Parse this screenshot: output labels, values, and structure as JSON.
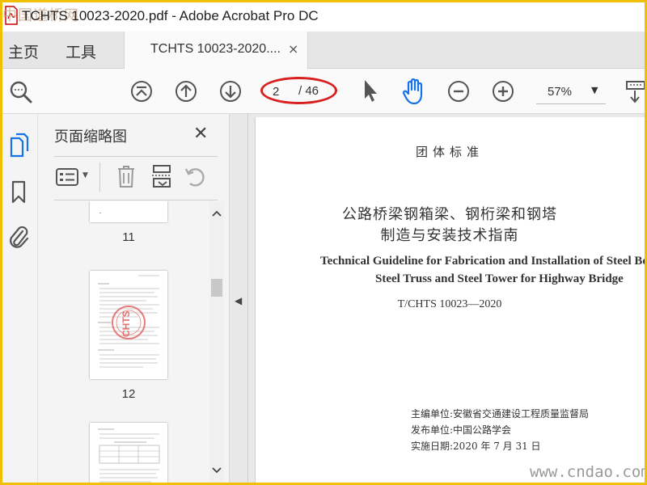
{
  "window": {
    "title": "TCHTS 10023-2020.pdf - Adobe Acrobat Pro DC",
    "watermark": "中国道桥网"
  },
  "tabs": {
    "home": "主页",
    "tools": "工具",
    "document": "TCHTS 10023-2020....",
    "close": "×"
  },
  "toolbar": {
    "current_page": "2",
    "total_pages": "/ 46",
    "zoom": "57%",
    "zoom_caret": "▼",
    "icons": [
      "find-text-icon",
      "first-page-icon",
      "previous-page-icon",
      "next-page-icon",
      "select-tool-icon",
      "hand-tool-icon",
      "zoom-out-icon",
      "zoom-in-icon",
      "page-display-icon"
    ],
    "accent_color": "#1473e6"
  },
  "thumbnail_panel": {
    "title": "页面缩略图",
    "close": "✕",
    "pages": [
      {
        "label": "11"
      },
      {
        "label": "12",
        "stamp": "CHTS"
      },
      {
        "label": ""
      }
    ]
  },
  "document": {
    "category": "团体标准",
    "title_cn_line1": "公路桥梁钢箱梁、钢桁梁和钢塔",
    "title_cn_line2": "制造与安装技术指南",
    "title_en_line1": "Technical Guideline for Fabrication and Installation of Steel Box",
    "title_en_line2": "Steel Truss and Steel Tower for Highway Bridge",
    "code": "T/CHTS  10023—2020",
    "editor": "主编单位:安徽省交通建设工程质量监督局",
    "publisher": "发布单位:中国公路学会",
    "effective": "实施日期:2020 年 7 月 31 日",
    "watermark": "www.cndao.com"
  }
}
